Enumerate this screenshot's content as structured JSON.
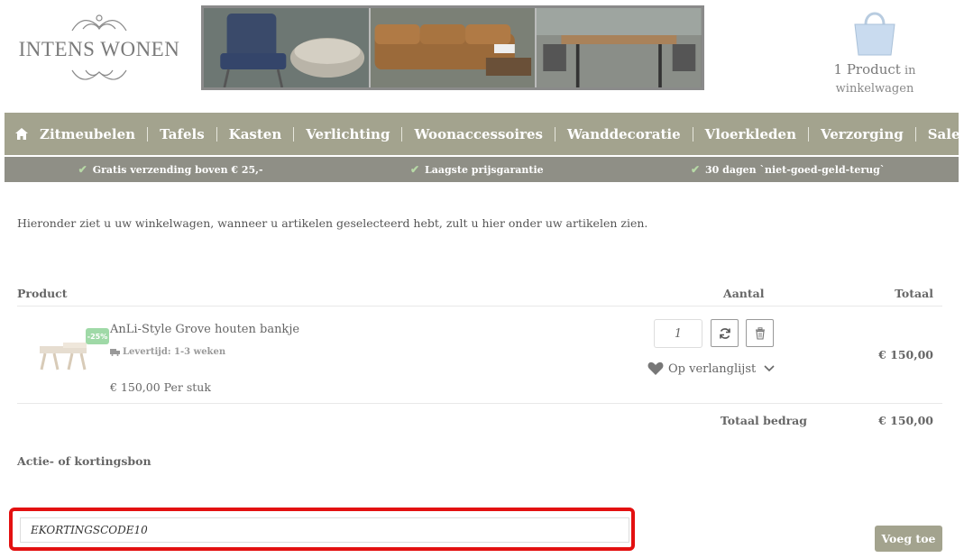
{
  "brand": {
    "logo_text": "INTENS WONEN"
  },
  "cart": {
    "count_text": "1 Product",
    "suffix": "in",
    "line2": "winkelwagen"
  },
  "nav": {
    "home_icon": "home-icon",
    "items": [
      "Zitmeubelen",
      "Tafels",
      "Kasten",
      "Verlichting",
      "Woonaccessoires",
      "Wanddecoratie",
      "Vloerkleden",
      "Verzorging",
      "Sale"
    ]
  },
  "usps": [
    "Gratis verzending boven € 25,-",
    "Laagste prijsgarantie",
    "30 dagen `niet-goed-geld-terug`"
  ],
  "intro": "Hieronder ziet u uw winkelwagen, wanneer u artikelen geselecteerd hebt, zult u hier onder uw artikelen zien.",
  "table": {
    "headers": {
      "product": "Product",
      "quantity": "Aantal",
      "total": "Totaal"
    },
    "rows": [
      {
        "name": "AnLi-Style Grove houten bankje",
        "badge": "-25%",
        "delivery": "Levertijd: 1-3 weken",
        "price": "€ 150,00 Per stuk",
        "quantity": "1",
        "wishlist": "Op verlanglijst",
        "total": "€ 150,00"
      }
    ],
    "sum_label": "Totaal bedrag",
    "sum_value": "€ 150,00"
  },
  "coupon": {
    "label": "Actie- of kortingsbon",
    "value": "EKORTINGSCODE10",
    "button": "Voeg toe"
  },
  "colors": {
    "nav_bg": "#a3a38e",
    "usp_bg": "#8f8f86",
    "badge": "#9fd9a7",
    "highlight": "#e31010"
  }
}
